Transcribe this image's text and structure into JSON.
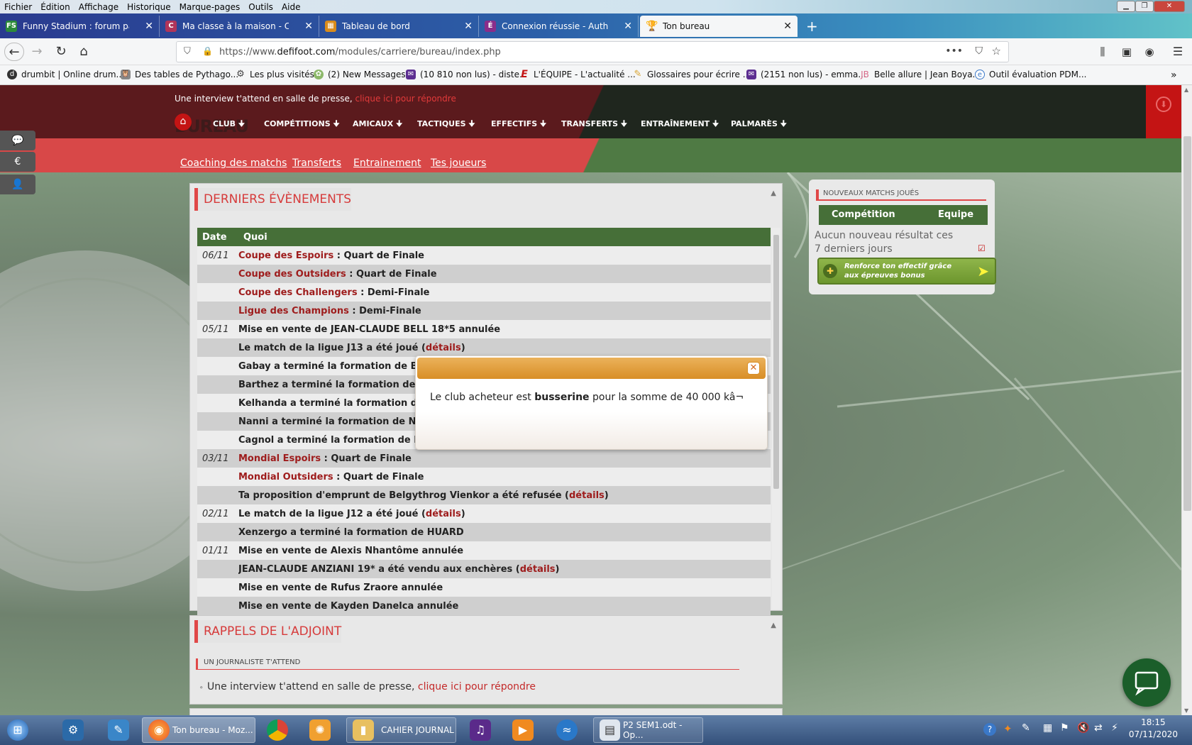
{
  "menubar": {
    "items": [
      "Fichier",
      "Édition",
      "Affichage",
      "Historique",
      "Marque-pages",
      "Outils",
      "Aide"
    ]
  },
  "tabs": [
    {
      "label": "Funny Stadium : forum partena",
      "icon": "fs-icon",
      "color": "#2c8a3a"
    },
    {
      "label": "Ma classe à la maison - CNED",
      "icon": "cned-icon",
      "color": "#b0355a"
    },
    {
      "label": "Tableau de bord",
      "icon": "dashboard-icon",
      "color": "#d98c1c"
    },
    {
      "label": "Connexion réussie - Authentifi",
      "icon": "auth-icon",
      "color": "#8a2d8a"
    },
    {
      "label": "Ton bureau",
      "icon": "trophy-icon",
      "color": "#d8a430"
    }
  ],
  "url": {
    "prefix": "https://www.",
    "domain": "defifoot.com",
    "path": "/modules/carriere/bureau/index.php"
  },
  "bookmarks": [
    {
      "label": "drumbit | Online drum...",
      "color": "#333"
    },
    {
      "label": "Des tables de Pythago...",
      "color": "#777"
    },
    {
      "label": "Les plus visités",
      "color": "#555"
    },
    {
      "label": "(2) New Messages!",
      "color": "#8cb86a"
    },
    {
      "label": "(10 810 non lus) - diste...",
      "color": "#5c2e91"
    },
    {
      "label": "L'ÉQUIPE - L'actualité ...",
      "color": "#c41414"
    },
    {
      "label": "Glossaires pour écrire ...",
      "color": "#d8a430"
    },
    {
      "label": "(2151 non lus) - emma...",
      "color": "#5c2e91"
    },
    {
      "label": "Belle allure | Jean Boya...",
      "color": "#d86a8a"
    },
    {
      "label": "Outil évaluation PDM...",
      "color": "#3a78c8"
    }
  ],
  "site": {
    "notice_text": "Une interview t'attend en salle de presse, ",
    "notice_link": "clique ici pour répondre",
    "page_label": "BUREAU",
    "nav": [
      "CLUB",
      "COMPÉTITIONS",
      "AMICAUX",
      "TACTIQUES",
      "EFFECTIFS",
      "TRANSFERTS",
      "ENTRAÎNEMENT",
      "PALMARÈS"
    ],
    "nav_arrow": "🠋",
    "sublinks": [
      "Coaching des matchs",
      "Transferts",
      "Entrainement",
      "Tes joueurs"
    ]
  },
  "events": {
    "title": "DERNIERS ÉVÈNEMENTS",
    "col_date": "Date",
    "col_what": "Quoi",
    "rows": [
      {
        "date": "06/11",
        "red": "Coupe des Espoirs",
        "text": " : Quart de Finale",
        "link": "",
        "tail": ""
      },
      {
        "date": "",
        "red": "Coupe des Outsiders",
        "text": " : Quart de Finale",
        "link": "",
        "tail": ""
      },
      {
        "date": "",
        "red": "Coupe des Challengers",
        "text": " : Demi-Finale",
        "link": "",
        "tail": ""
      },
      {
        "date": "",
        "red": "Ligue des Champions",
        "text": " : Demi-Finale",
        "link": "",
        "tail": ""
      },
      {
        "date": "05/11",
        "red": "",
        "text": "Mise en vente de JEAN-CLAUDE BELL 18*5 annulée",
        "link": "",
        "tail": ""
      },
      {
        "date": "",
        "red": "",
        "text": "Le match de la ligue J13 a été joué (",
        "link": "détails",
        "tail": ")"
      },
      {
        "date": "",
        "red": "",
        "text": "Gabay a terminé la formation de B",
        "link": "",
        "tail": ""
      },
      {
        "date": "",
        "red": "",
        "text": "Barthez a terminé la formation de",
        "link": "",
        "tail": ""
      },
      {
        "date": "",
        "red": "",
        "text": "Kelhanda a terminé la formation d",
        "link": "",
        "tail": ""
      },
      {
        "date": "",
        "red": "",
        "text": "Nanni a terminé la formation de N",
        "link": "",
        "tail": ""
      },
      {
        "date": "",
        "red": "",
        "text": "Cagnol a terminé la formation de I",
        "link": "",
        "tail": ""
      },
      {
        "date": "03/11",
        "red": "Mondial Espoirs",
        "text": " : Quart de Finale",
        "link": "",
        "tail": ""
      },
      {
        "date": "",
        "red": "Mondial Outsiders",
        "text": " : Quart de Finale",
        "link": "",
        "tail": ""
      },
      {
        "date": "",
        "red": "",
        "text": "Ta proposition d'emprunt de Belgythrog Vienkor a été refusée (",
        "link": "détails",
        "tail": ")"
      },
      {
        "date": "02/11",
        "red": "",
        "text": "Le match de la ligue J12 a été joué (",
        "link": "détails",
        "tail": ")"
      },
      {
        "date": "",
        "red": "",
        "text": "Xenzergo a terminé la formation de HUARD",
        "link": "",
        "tail": ""
      },
      {
        "date": "01/11",
        "red": "",
        "text": "Mise en vente de Alexis Nhantôme annulée",
        "link": "",
        "tail": ""
      },
      {
        "date": "",
        "red": "",
        "text": "JEAN-CLAUDE ANZIANI 19* a été vendu aux enchères (",
        "link": "détails",
        "tail": ")"
      },
      {
        "date": "",
        "red": "",
        "text": "Mise en vente de Rufus Zraore annulée",
        "link": "",
        "tail": ""
      },
      {
        "date": "",
        "red": "",
        "text": "Mise en vente de Kayden Danelca annulée",
        "link": "",
        "tail": ""
      }
    ]
  },
  "modal": {
    "text_before": "Le club acheteur est ",
    "club": "busserine",
    "text_after": " pour la somme de 40 000 kâ¬"
  },
  "new_matches": {
    "title": "NOUVEAUX MATCHS JOUÉS",
    "col_comp": "Compétition",
    "col_team": "Equipe",
    "empty": "Aucun nouveau résultat ces 7 derniers jours",
    "banner": "Renforce ton effectif grâce aux épreuves bonus"
  },
  "reminders": {
    "title": "RAPPELS DE L'ADJOINT",
    "subtitle": "UN JOURNALISTE T'ATTEND",
    "line_text": "Une interview t'attend en salle de presse, ",
    "line_link": "clique ici pour répondre"
  },
  "taskbar": {
    "firefox_window": "Ton bureau - Moz...",
    "folder_window": "CAHIER JOURNAL",
    "writer_window": "P2 SEM1.odt - Op...",
    "time": "18:15",
    "date": "07/11/2020"
  },
  "colors": {
    "accent_red": "#d63b3b",
    "green_header": "#466f38",
    "modal_orange": "#d88e26"
  }
}
